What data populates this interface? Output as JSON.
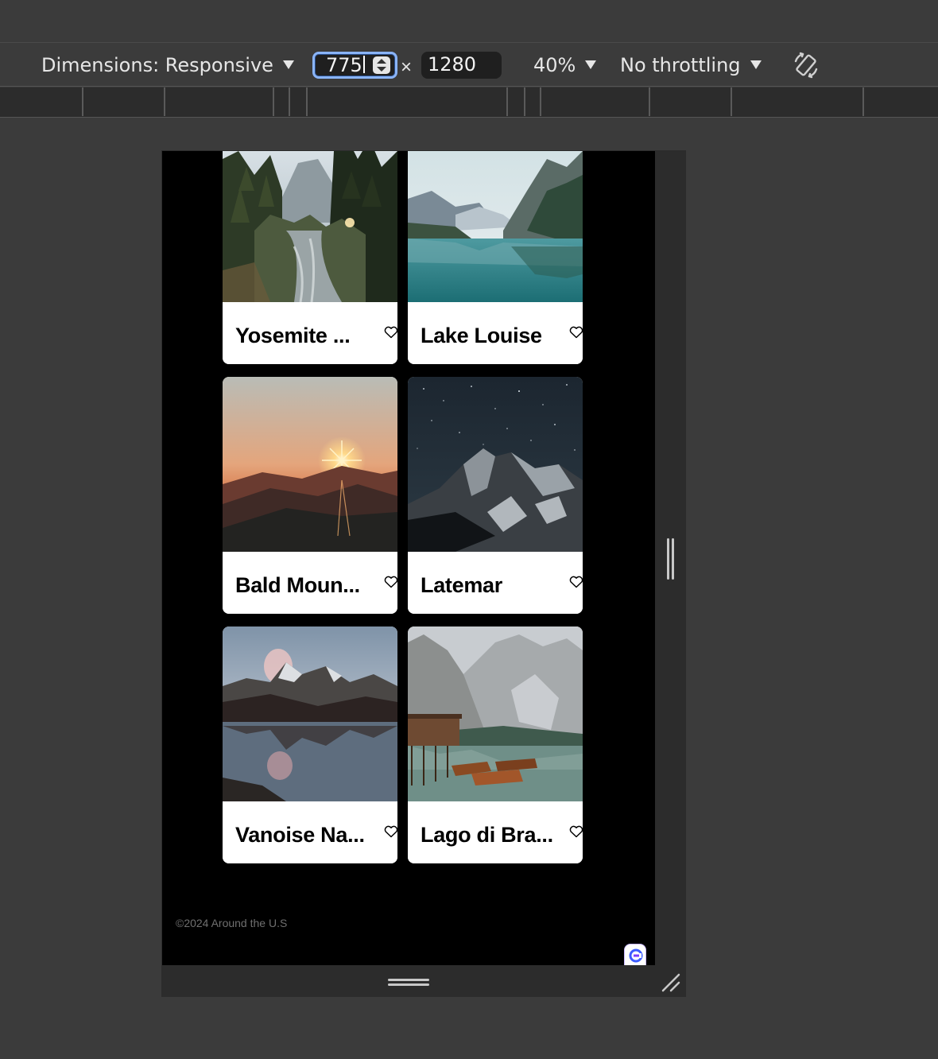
{
  "devtools": {
    "dimensions_label": "Dimensions: Responsive",
    "width_value": "775",
    "height_value": "1280",
    "times_symbol": "×",
    "zoom_label": "40%",
    "throttling_label": "No throttling"
  },
  "page": {
    "cards": [
      {
        "title": "Yosemite ...",
        "scene": "forest-river"
      },
      {
        "title": "Lake Louise",
        "scene": "mountain-lake"
      },
      {
        "title": "Bald Moun...",
        "scene": "sunset-hills"
      },
      {
        "title": "Latemar",
        "scene": "night-mountain"
      },
      {
        "title": "Vanoise Na...",
        "scene": "reflection-lake"
      },
      {
        "title": "Lago di Bra...",
        "scene": "boats-dock"
      }
    ],
    "footer": "©2024 Around the U.S"
  },
  "colors": {
    "devtools_bg": "#3b3b3b",
    "input_focus": "#8ab4f8",
    "page_bg": "#000000",
    "card_bg": "#ffffff"
  }
}
